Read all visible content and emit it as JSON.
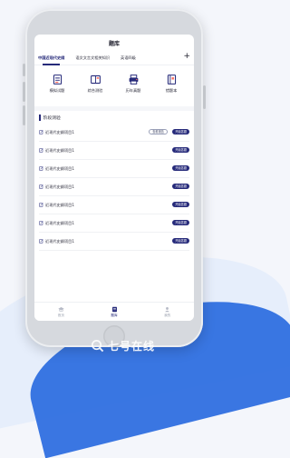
{
  "app": {
    "title": "题库"
  },
  "tabs": [
    {
      "label": "中国近现代史纲"
    },
    {
      "label": "语文文言文相关知识"
    },
    {
      "label": "英语四级"
    }
  ],
  "tab_add": "+",
  "categories": [
    {
      "label": "模拟试题",
      "icon": "document-icon"
    },
    {
      "label": "综合测验",
      "icon": "book-icon"
    },
    {
      "label": "历年真题",
      "icon": "printer-icon"
    },
    {
      "label": "错题本",
      "icon": "notebook-icon"
    }
  ],
  "section": {
    "title": "阶段测验"
  },
  "quiz_items": [
    {
      "name": "近现代史纲项目1",
      "report": "查看报告",
      "action": "开始答题"
    },
    {
      "name": "近现代史纲项目1",
      "action": "开始答题"
    },
    {
      "name": "近现代史纲项目1",
      "action": "开始答题"
    },
    {
      "name": "近现代史纲项目1",
      "action": "开始答题"
    },
    {
      "name": "近现代史纲项目1",
      "action": "开始答题"
    },
    {
      "name": "近现代史纲项目1",
      "action": "开始答题"
    },
    {
      "name": "近现代史纲项目1",
      "action": "开始答题"
    }
  ],
  "bottom_nav": [
    {
      "label": "首页",
      "icon": "graduation-cap-icon",
      "active": false
    },
    {
      "label": "题库",
      "icon": "list-icon",
      "active": true
    },
    {
      "label": "我的",
      "icon": "user-icon",
      "active": false
    }
  ],
  "watermark": {
    "text": "七号在线"
  },
  "colors": {
    "accent": "#262a7a",
    "brand_blue": "#2f6fe0"
  }
}
